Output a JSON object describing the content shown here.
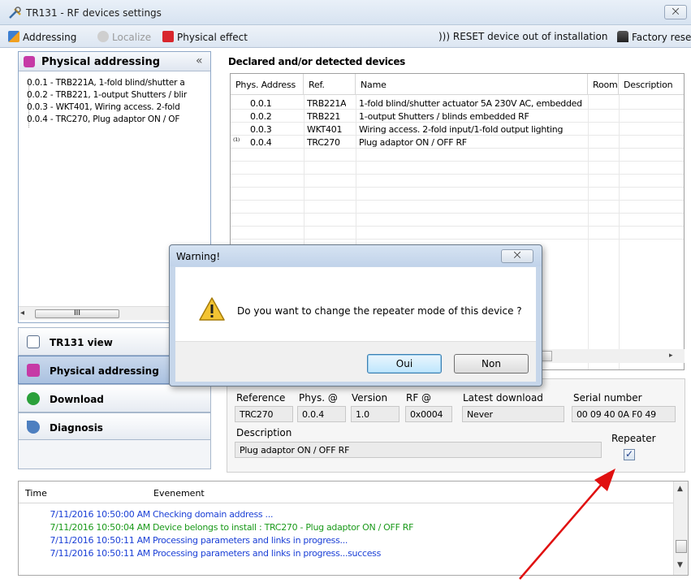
{
  "window": {
    "title": "TR131 - RF devices settings",
    "close_glyph": "⨉"
  },
  "toolbar": {
    "addressing": "Addressing",
    "localize": "Localize",
    "physical_effect": "Physical effect",
    "reset": ")))  RESET device out of installation",
    "factory_reset": "Factory reset"
  },
  "left_panel": {
    "title": "Physical addressing",
    "collapse": "«",
    "tree": [
      "0.0.1 - TRB221A, 1-fold blind/shutter a",
      "0.0.2 - TRB221, 1-output Shutters / blir",
      "0.0.3 - WKT401, Wiring access. 2-fold",
      "0.0.4 - TRC270, Plug adaptor ON / OF"
    ],
    "scroll_left": "◂",
    "scroll_thumb": "III"
  },
  "nav": {
    "tr131_view": "TR131 view",
    "physical_addressing": "Physical addressing",
    "download": "Download",
    "diagnosis": "Diagnosis"
  },
  "declared": {
    "title": "Declared and/or detected devices",
    "columns": [
      "Phys. Address",
      "Ref.",
      "Name",
      "Room",
      "Description"
    ],
    "rows": [
      {
        "addr": "0.0.1",
        "ref": "TRB221A",
        "name": "1-fold blind/shutter actuator 5A 230V AC, embedded"
      },
      {
        "addr": "0.0.2",
        "ref": "TRB221",
        "name": "1-output Shutters / blinds embedded RF"
      },
      {
        "addr": "0.0.3",
        "ref": "WKT401",
        "name": "Wiring access. 2-fold input/1-fold output lighting"
      },
      {
        "addr": "0.0.4",
        "ref": "TRC270",
        "name": "Plug adaptor ON / OFF RF"
      }
    ],
    "repeater_marker": "⁽¹⁾",
    "scroll_right": "▸"
  },
  "details": {
    "reference_label": "Reference",
    "reference_value": "TRC270",
    "phys_label": "Phys. @",
    "phys_value": "0.0.4",
    "version_label": "Version",
    "version_value": "1.0",
    "rf_label": "RF @",
    "rf_value": "0x0004",
    "latest_label": "Latest download",
    "latest_value": "Never",
    "serial_label": "Serial number",
    "serial_value": "00 09 40 0A F0 49",
    "description_label": "Description",
    "description_value": "Plug adaptor ON / OFF RF",
    "repeater_label": "Repeater",
    "repeater_checked": true,
    "check_glyph": "✓"
  },
  "log": {
    "col_time": "Time",
    "col_event": "Evenement",
    "rows": [
      {
        "time": "7/11/2016 10:50:00 AM",
        "text": "Checking domain address ...",
        "color": "#1a3fd6"
      },
      {
        "time": "7/11/2016 10:50:04 AM",
        "text": "Device belongs to install : TRC270 - Plug adaptor ON / OFF RF",
        "color": "#1b9a1b"
      },
      {
        "time": "7/11/2016 10:50:11 AM",
        "text": "Processing parameters and links in progress...",
        "color": "#1a3fd6"
      },
      {
        "time": "7/11/2016 10:50:11 AM",
        "text": "Processing parameters and links in progress...success",
        "color": "#1a3fd6"
      }
    ],
    "scroll_up": "▲",
    "scroll_down": "▼"
  },
  "dialog": {
    "title": "Warning!",
    "close_glyph": "⨉",
    "message": "Do you want to change the repeater mode of this device ?",
    "yes": "Oui",
    "no": "Non"
  },
  "colors": {
    "accent_purple": "#c63aa6",
    "arrow_red": "#e01010",
    "selection_blue": "#aac1e0"
  }
}
